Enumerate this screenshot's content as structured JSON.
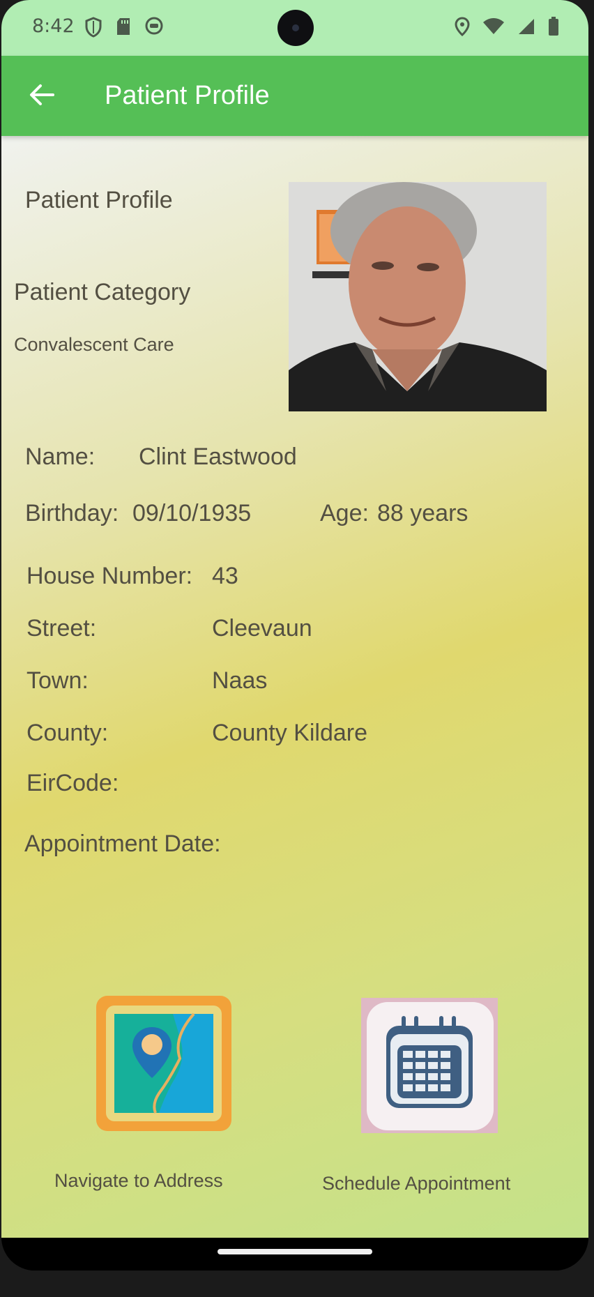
{
  "status_bar": {
    "time": "8:42"
  },
  "app_bar": {
    "title": "Patient Profile"
  },
  "profile": {
    "heading": "Patient Profile",
    "category_label": "Patient Category",
    "category_value": "Convalescent Care",
    "name_label": "Name:",
    "name_value": "Clint Eastwood",
    "birthday_label": "Birthday:",
    "birthday_value": "09/10/1935",
    "age_label": "Age:",
    "age_value": "88 years",
    "house_label": "House Number:",
    "house_value": "43",
    "street_label": "Street:",
    "street_value": "Cleevaun",
    "town_label": "Town:",
    "town_value": "Naas",
    "county_label": "County:",
    "county_value": "County Kildare",
    "eircode_label": "EirCode:",
    "appointment_label": "Appointment Date:"
  },
  "actions": {
    "navigate_label": "Navigate to Address",
    "schedule_label": "Schedule Appointment"
  },
  "colors": {
    "app_bar": "#55bf56",
    "status_bar": "#b1edb3",
    "text": "#534f42"
  }
}
